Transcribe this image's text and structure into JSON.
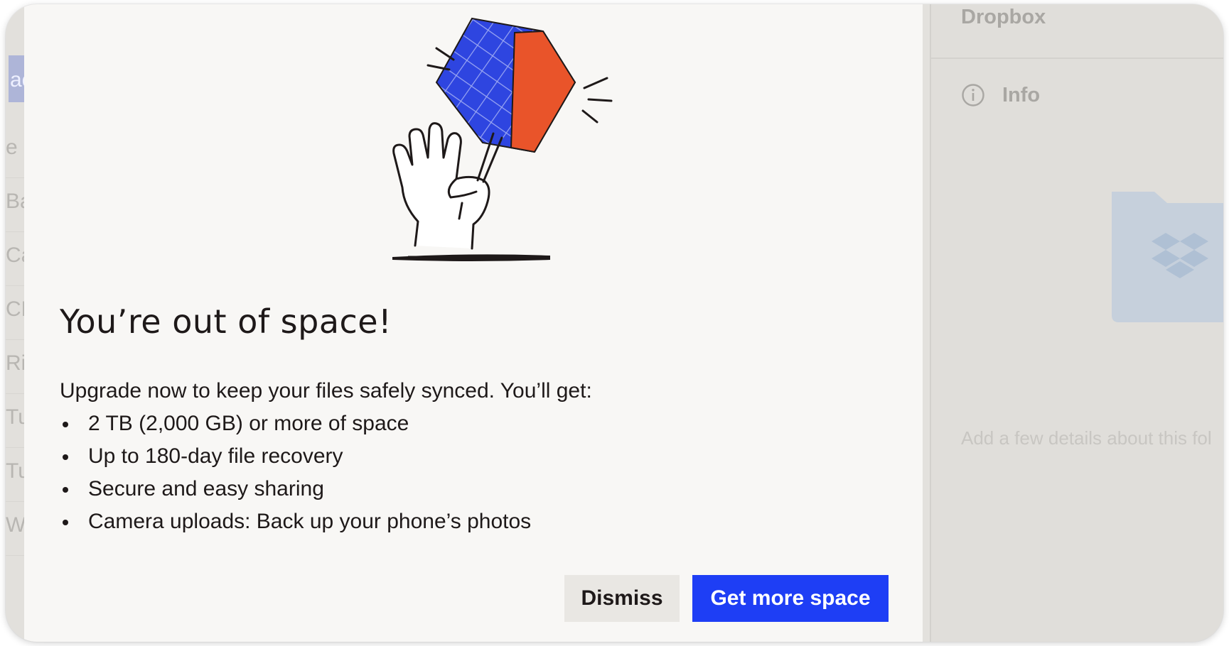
{
  "file_list": {
    "thumb_text": "ac",
    "rows": [
      "e",
      "Ba",
      "Ca",
      "CE",
      "Ri",
      "Tu",
      "Tu",
      "W"
    ]
  },
  "details": {
    "title": "Dropbox",
    "info_label": "Info",
    "description_placeholder": "Add a few details about this fol"
  },
  "modal": {
    "headline": "You’re out of space!",
    "intro": "Upgrade now to keep your files safely synced. You’ll get:",
    "benefits": [
      "2 TB (2,000 GB) or more of space",
      "Up to 180-day file recovery",
      "Secure and easy sharing",
      "Camera uploads: Back up your phone’s photos"
    ],
    "dismiss_label": "Dismiss",
    "primary_label": "Get more space"
  },
  "colors": {
    "primary_button": "#1e3ef5",
    "illustration_blue": "#2e45e0",
    "illustration_orange": "#e9542a"
  },
  "icons": [
    "info-icon",
    "folder-icon",
    "dropbox-logo-icon",
    "hand-holding-box-illustration"
  ]
}
